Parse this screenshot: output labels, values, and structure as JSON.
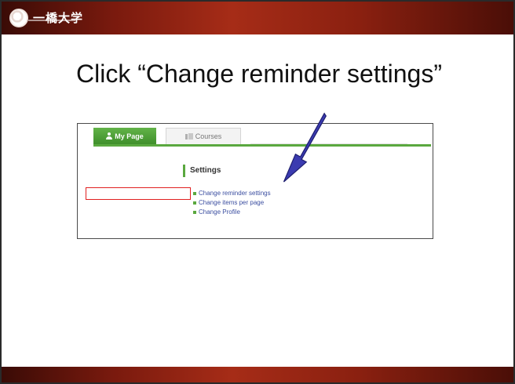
{
  "header": {
    "logo_text": "一橋大学"
  },
  "slide": {
    "title": "Click “Change reminder settings”"
  },
  "screenshot": {
    "tabs": [
      {
        "label": "My Page",
        "icon": "person-icon"
      },
      {
        "label": "Courses",
        "icon": "courses-icon"
      }
    ],
    "settings": {
      "heading": "Settings",
      "items": [
        {
          "label": "Change reminder settings"
        },
        {
          "label": "Change items per page"
        },
        {
          "label": "Change Profile"
        }
      ]
    }
  },
  "colors": {
    "brand_dark_red": "#7a1a0e",
    "brand_red": "#a62c17",
    "tab_green": "#5aa83f",
    "link_blue": "#3b4ea0",
    "highlight_red": "#e02020",
    "arrow_blue": "#3b3bb0"
  }
}
